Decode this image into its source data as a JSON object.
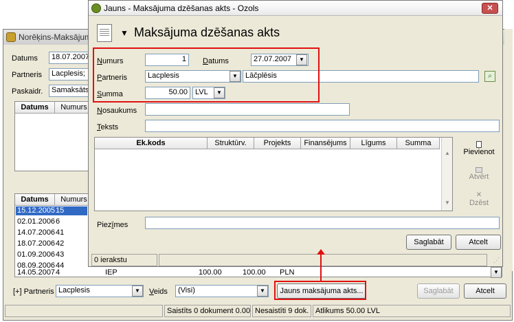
{
  "bg_window": {
    "title": "Norēķins-Maksājum",
    "labels": {
      "date": "Datums",
      "partner": "Partneris",
      "explanation": "Paskaidr."
    },
    "date_value": "18.07.2007",
    "partner_value": "Lacplesis;",
    "explanation_value": "Samaksāts",
    "top_table_headers": [
      "Datums",
      "Numurs"
    ],
    "bottom_table_headers": [
      "Datums",
      "Numurs"
    ],
    "rows": [
      {
        "date": "15.12.2005",
        "num": "15",
        "selected": true
      },
      {
        "date": "02.01.2006",
        "num": "6"
      },
      {
        "date": "14.07.2006",
        "num": "41"
      },
      {
        "date": "18.07.2006",
        "num": "42"
      },
      {
        "date": "01.09.2006",
        "num": "43"
      },
      {
        "date": "08.09.2006",
        "num": "44"
      },
      {
        "date": "14.05.2007",
        "num": "4",
        "type": "IEP",
        "amount1": "100.00",
        "amount2": "100.00",
        "currency": "PLN"
      }
    ],
    "filter": {
      "partner_label": "[+] Partneris",
      "partner_value": "Lacplesis",
      "type_label": "Veids",
      "type_value": "(Visi)"
    },
    "buttons": {
      "new_act": "Jauns maksājuma akts...",
      "save": "Saglabāt",
      "cancel": "Atcelt"
    },
    "status": {
      "linked": "Saistīts 0 dokument 0.00 LVL",
      "unlinked": "Nesaistīti 9 dok.",
      "remaining": "Atlikums 50.00 LVL"
    }
  },
  "fg_window": {
    "title": "Jauns - Maksājuma dzēšanas akts - Ozols",
    "heading": "Maksājuma dzēšanas akts",
    "labels": {
      "number": "Numurs",
      "date": "Datums",
      "partner": "Partneris",
      "sum": "Summa",
      "name": "Nosaukums",
      "text": "Teksts",
      "notes": "Piezīmes"
    },
    "number_value": "1",
    "date_value": "27.07.2007",
    "partner_code": "Lacplesis",
    "partner_name": "Lāčplēsis",
    "sum_value": "50.00",
    "currency": "LVL",
    "table_headers": [
      "Ek.kods",
      "Struktūrv.",
      "Projekts",
      "Finansējums",
      "Līgums",
      "Summa"
    ],
    "side_buttons": {
      "add": "Pievienot",
      "open": "Atvērt",
      "delete": "Dzēst"
    },
    "buttons": {
      "save": "Saglabāt",
      "cancel": "Atcelt"
    },
    "status": "0 ierakstu"
  },
  "colors": {
    "highlight": "#e01010",
    "selection": "#316ac5",
    "titlebar_close": "#c75050"
  }
}
